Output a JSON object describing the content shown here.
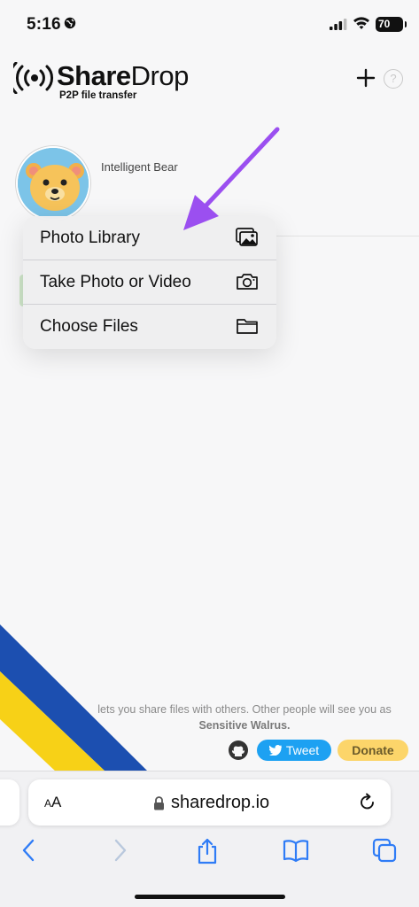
{
  "status_bar": {
    "time": "5:16",
    "battery": "70"
  },
  "header": {
    "brand_bold": "Share",
    "brand_light": "Drop",
    "tagline": "P2P file transfer"
  },
  "user": {
    "name": "Intelligent Bear"
  },
  "menu": {
    "items": [
      {
        "label": "Photo Library",
        "icon": "photo-library-icon"
      },
      {
        "label": "Take Photo or Video",
        "icon": "camera-icon"
      },
      {
        "label": "Choose Files",
        "icon": "folder-icon"
      }
    ]
  },
  "footer": {
    "text": "lets you share files with others. Other people will see you as",
    "peer_name": "Sensitive Walrus.",
    "tweet_label": "Tweet",
    "donate_label": "Donate"
  },
  "browser": {
    "url": "sharedrop.io",
    "aa_label_small": "A",
    "aa_label_large": "A"
  },
  "colors": {
    "accent_arrow": "#9b4ff0",
    "tweet": "#1da1f2",
    "donate": "#fcd56a",
    "stripe_blue": "#1c4fb0",
    "stripe_yellow": "#f7d117"
  }
}
